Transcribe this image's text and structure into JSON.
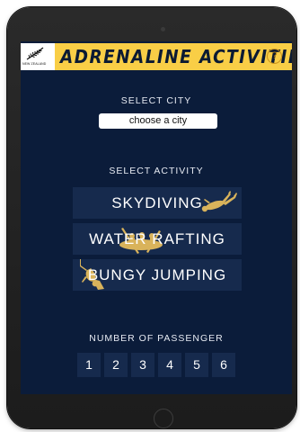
{
  "header": {
    "logo_text": "NEW ZEALAND",
    "title": "ADRENALINE ACTIVITIES",
    "help_symbol": "?"
  },
  "city": {
    "label": "SELECT CITY",
    "selected": "choose a city"
  },
  "activity": {
    "label": "SELECT ACTIVITY",
    "options": [
      "SKYDIVING",
      "WATER RAFTING",
      "BUNGY JUMPING"
    ]
  },
  "passengers": {
    "label": "NUMBER OF PASSENGER",
    "options": [
      "1",
      "2",
      "3",
      "4",
      "5",
      "6"
    ]
  },
  "icons": {
    "logo": "silver-fern-icon",
    "help": "help-icon",
    "skydiving": "skydiver-icon",
    "rafting": "raft-icon",
    "bungy": "bungy-jumper-icon"
  },
  "colors": {
    "background": "#0b1c3a",
    "header": "#f9ce46",
    "button": "#162a4d",
    "icon_gold": "#d9b35b"
  }
}
